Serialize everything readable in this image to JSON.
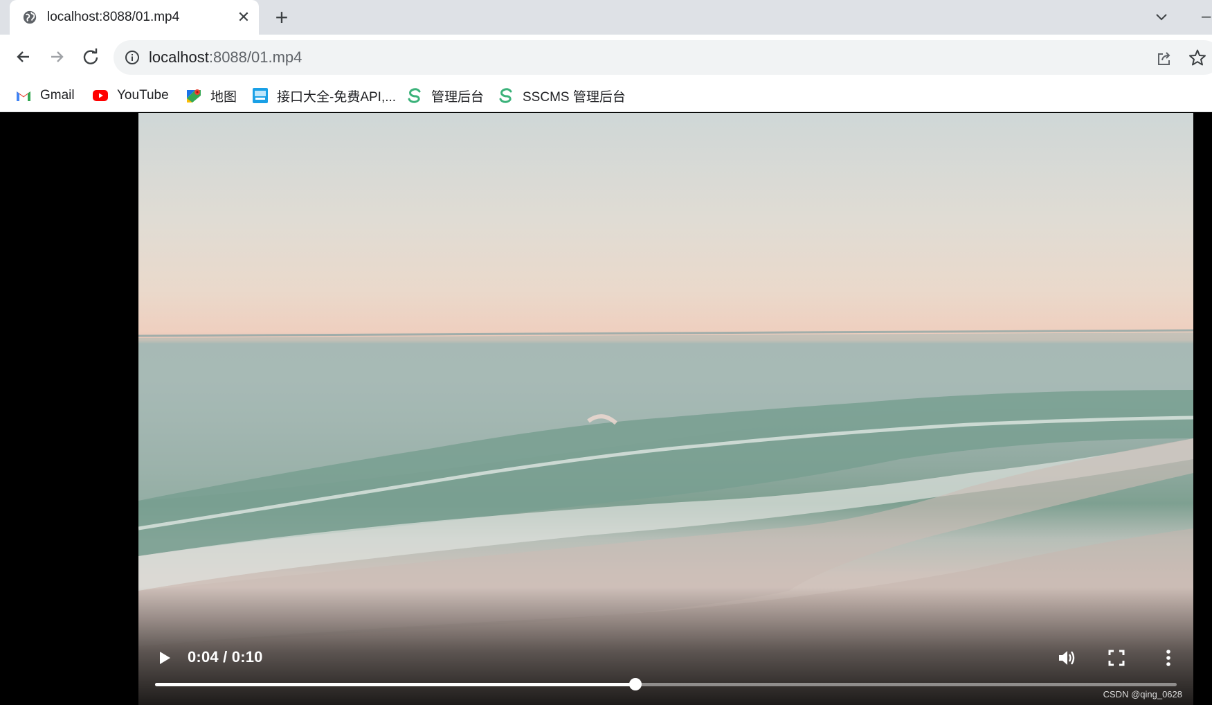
{
  "tab": {
    "title": "localhost:8088/01.mp4",
    "close_glyph": "✕",
    "new_tab_glyph": "+"
  },
  "window": {
    "minimize_glyph": "–"
  },
  "address_bar": {
    "host": "localhost",
    "rest": ":8088/01.mp4"
  },
  "bookmarks": [
    {
      "label": "Gmail",
      "icon": "gmail-icon"
    },
    {
      "label": "YouTube",
      "icon": "youtube-icon"
    },
    {
      "label": "地图",
      "icon": "maps-icon"
    },
    {
      "label": "接口大全-免费API,...",
      "icon": "api-site-icon"
    },
    {
      "label": "管理后台",
      "icon": "sscms-icon"
    },
    {
      "label": "SSCMS 管理后台",
      "icon": "sscms-icon"
    }
  ],
  "video": {
    "time_display": "0:04 / 0:10",
    "progress": 0.47,
    "watermark": "CSDN @qing_0628"
  },
  "colors": {
    "tabstrip_bg": "#dee1e6",
    "omnibox_bg": "#f1f3f4",
    "gmail_red": "#ea4335",
    "youtube_red": "#ff0000",
    "sscms_green": "#3bb27a"
  }
}
